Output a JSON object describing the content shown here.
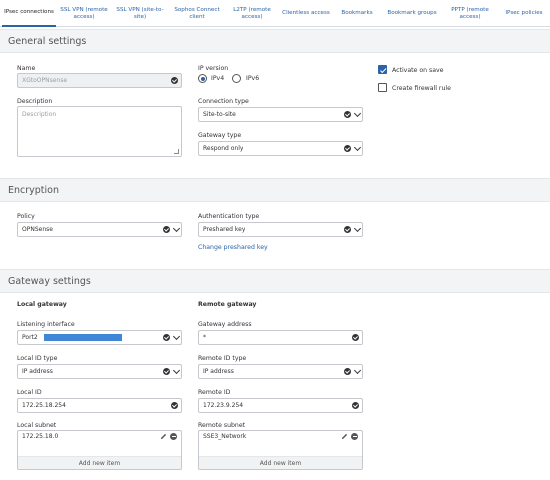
{
  "tabs": [
    {
      "label": "IPsec connections",
      "active": true
    },
    {
      "label": "SSL VPN (remote access)"
    },
    {
      "label": "SSL VPN (site-to-site)"
    },
    {
      "label": "Sophos Connect client"
    },
    {
      "label": "L2TP (remote access)"
    },
    {
      "label": "Clientless access"
    },
    {
      "label": "Bookmarks"
    },
    {
      "label": "Bookmark groups"
    },
    {
      "label": "PPTP (remote access)"
    },
    {
      "label": "IPsec policies"
    }
  ],
  "general": {
    "title": "General settings",
    "name_label": "Name",
    "name_value": "XGtoOPNsense",
    "description_label": "Description",
    "description_placeholder": "Description",
    "ip_version_label": "IP version",
    "ipv4_label": "IPv4",
    "ipv6_label": "IPv6",
    "ip_version_selected": "IPv4",
    "connection_type_label": "Connection type",
    "connection_type_value": "Site-to-site",
    "gateway_type_label": "Gateway type",
    "gateway_type_value": "Respond only",
    "activate_on_save_label": "Activate on save",
    "activate_on_save_checked": true,
    "create_firewall_rule_label": "Create firewall rule",
    "create_firewall_rule_checked": false
  },
  "encryption": {
    "title": "Encryption",
    "policy_label": "Policy",
    "policy_value": "OPNSense",
    "auth_type_label": "Authentication type",
    "auth_type_value": "Preshared key",
    "change_key_link": "Change preshared key"
  },
  "gateway": {
    "title": "Gateway settings",
    "local": {
      "heading": "Local gateway",
      "listening_interface_label": "Listening interface",
      "listening_interface_value": "Port2",
      "local_id_type_label": "Local ID type",
      "local_id_type_value": "IP address",
      "local_id_label": "Local ID",
      "local_id_value": "172.25.18.254",
      "local_subnet_label": "Local subnet",
      "local_subnet_value": "172.25.18.0",
      "add_new_item": "Add new item"
    },
    "remote": {
      "heading": "Remote gateway",
      "gateway_address_label": "Gateway address",
      "gateway_address_value": "*",
      "remote_id_type_label": "Remote ID type",
      "remote_id_type_value": "IP address",
      "remote_id_label": "Remote ID",
      "remote_id_value": "172.23.9.254",
      "remote_subnet_label": "Remote subnet",
      "remote_subnet_value": "SSE3_Network",
      "add_new_item": "Add new item"
    }
  },
  "colors": {
    "accent": "#2a63a8",
    "section_bg": "#f3f4f5",
    "redaction": "#3f87d6"
  }
}
